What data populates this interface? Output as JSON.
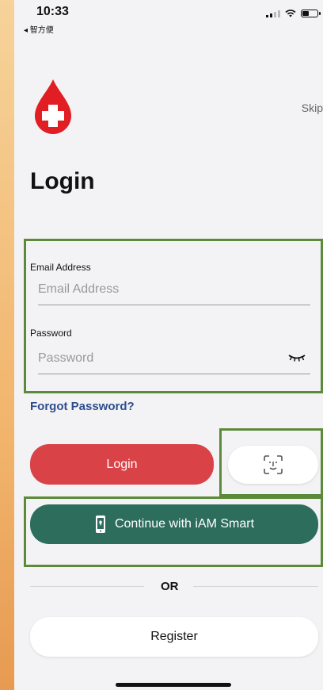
{
  "status_bar": {
    "time": "10:33",
    "back_app": "◂ 智方便"
  },
  "header": {
    "skip": "Skip",
    "title": "Login"
  },
  "form": {
    "email_label": "Email Address",
    "email_placeholder": "Email Address",
    "password_label": "Password",
    "password_placeholder": "Password"
  },
  "links": {
    "forgot": "Forgot Password?"
  },
  "buttons": {
    "login": "Login",
    "iam_smart": "Continue with iAM Smart",
    "register": "Register"
  },
  "divider": {
    "or": "OR"
  },
  "colors": {
    "login_red": "#d94246",
    "iam_green": "#2d6d5c",
    "link_blue": "#2d4d8c",
    "highlight_green": "#5c8a3a"
  },
  "icons": {
    "logo": "blood-drop-cross-icon",
    "password_toggle": "eye-closed-icon",
    "biometric": "face-id-icon",
    "iam": "iam-smart-phone-icon"
  }
}
